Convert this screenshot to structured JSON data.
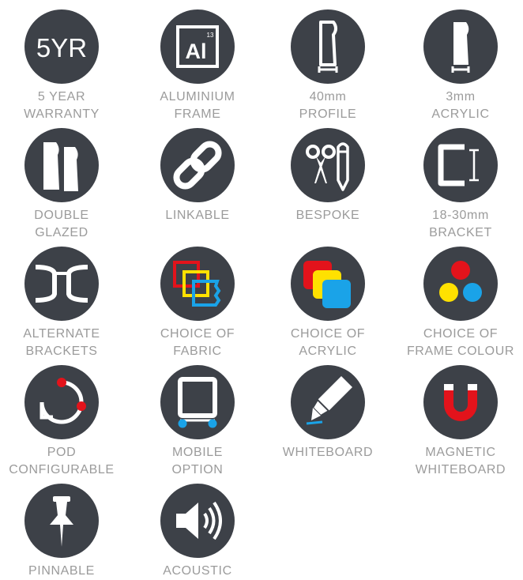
{
  "colors": {
    "circle": "#3d4148",
    "icon": "#ffffff",
    "label": "#9b9b9b",
    "red": "#e3131b",
    "yellow": "#ffe100",
    "blue": "#1aa3e8"
  },
  "features": [
    {
      "label": "5 YEAR\nWARRANTY",
      "icon": "5yr-text-icon",
      "icon_text": "5YR"
    },
    {
      "label": "ALUMINIUM\nFRAME",
      "icon": "aluminium-element-icon",
      "icon_text": "Al",
      "icon_number": "13"
    },
    {
      "label": "40mm\nPROFILE",
      "icon": "profile-icon"
    },
    {
      "label": "3mm\nACRYLIC",
      "icon": "acrylic-panel-icon"
    },
    {
      "label": "DOUBLE\nGLAZED",
      "icon": "double-glazed-icon"
    },
    {
      "label": "LINKABLE",
      "icon": "chain-link-icon"
    },
    {
      "label": "BESPOKE",
      "icon": "scissors-pencil-icon"
    },
    {
      "label": "18-30mm\nBRACKET",
      "icon": "bracket-icon"
    },
    {
      "label": "ALTERNATE\nBRACKETS",
      "icon": "alternate-brackets-icon"
    },
    {
      "label": "CHOICE OF\nFABRIC",
      "icon": "fabric-swatches-icon"
    },
    {
      "label": "CHOICE OF\nACRYLIC",
      "icon": "acrylic-swatches-icon"
    },
    {
      "label": "CHOICE OF\nFRAME COLOUR",
      "icon": "colour-dots-icon"
    },
    {
      "label": "POD\nCONFIGURABLE",
      "icon": "pod-ring-icon"
    },
    {
      "label": "MOBILE\nOPTION",
      "icon": "mobile-frame-icon"
    },
    {
      "label": "WHITEBOARD",
      "icon": "marker-pen-icon"
    },
    {
      "label": "MAGNETIC\nWHITEBOARD",
      "icon": "magnet-icon"
    },
    {
      "label": "PINNABLE",
      "icon": "push-pin-icon"
    },
    {
      "label": "ACOUSTIC",
      "icon": "speaker-icon"
    }
  ]
}
